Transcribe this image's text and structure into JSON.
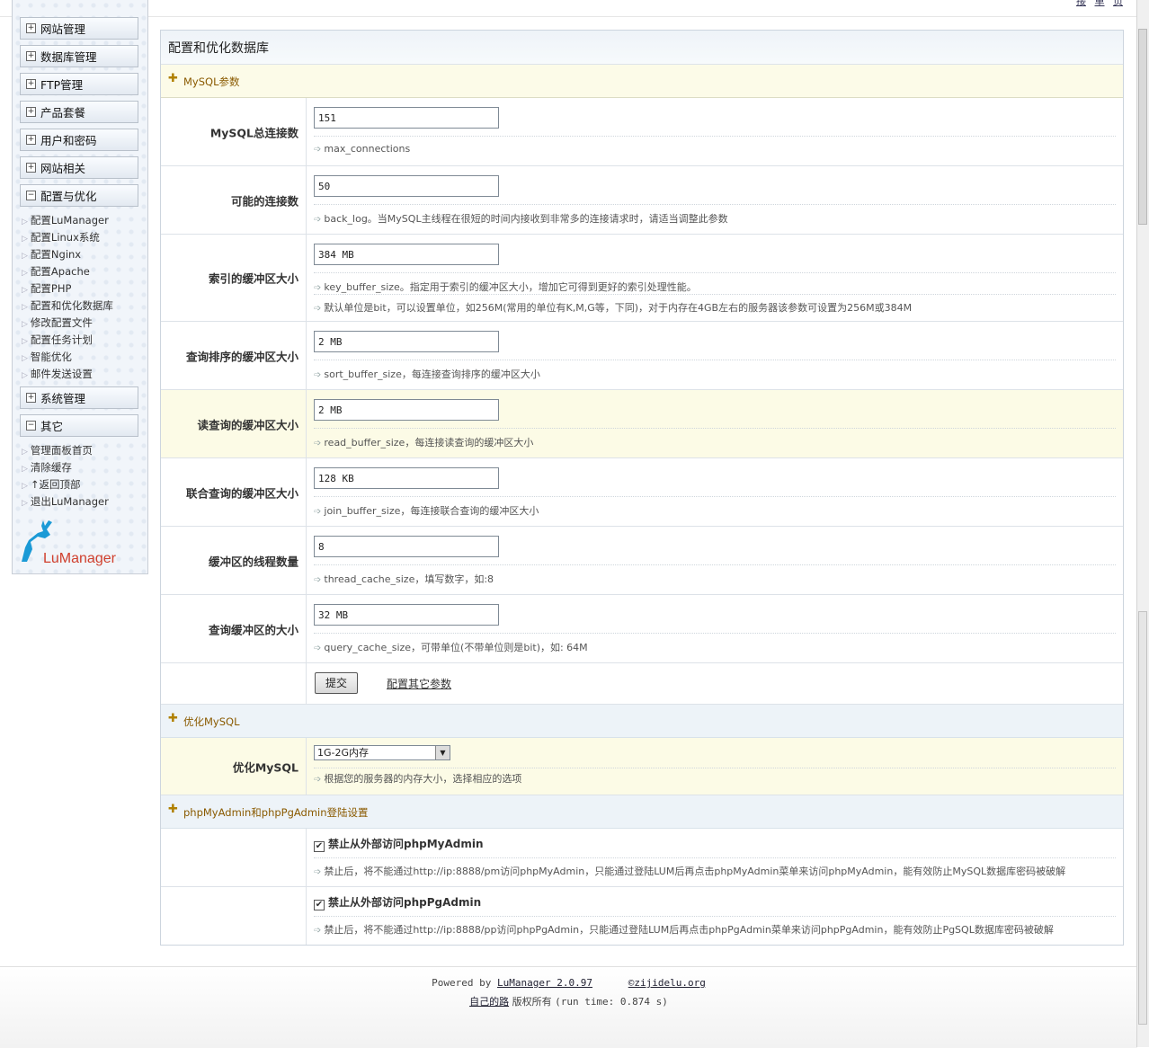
{
  "topbar": {
    "icons": "△ ⊘ ▽",
    "links": [
      "接",
      "单",
      "页"
    ]
  },
  "sidebar": {
    "menus": [
      {
        "label": "网站管理",
        "state": "+"
      },
      {
        "label": "数据库管理",
        "state": "+"
      },
      {
        "label": "FTP管理",
        "state": "+"
      },
      {
        "label": "产品套餐",
        "state": "+"
      },
      {
        "label": "用户和密码",
        "state": "+"
      },
      {
        "label": "网站相关",
        "state": "+"
      },
      {
        "label": "配置与优化",
        "state": "−"
      },
      {
        "label": "系统管理",
        "state": "+"
      },
      {
        "label": "其它",
        "state": "−"
      }
    ],
    "config_items": [
      "配置LuManager",
      "配置Linux系统",
      "配置Nginx",
      "配置Apache",
      "配置PHP",
      "配置和优化数据库",
      "修改配置文件",
      "配置任务计划",
      "智能优化",
      "邮件发送设置"
    ],
    "other_items": [
      "管理面板首页",
      "清除缓存",
      "↑返回顶部",
      "退出LuManager"
    ],
    "logo_text": "LuManager"
  },
  "main": {
    "title": "配置和优化数据库",
    "mysql_section": "MySQL参数",
    "params": [
      {
        "label": "MySQL总连接数",
        "value": "151",
        "hints": [
          "max_connections"
        ]
      },
      {
        "label": "可能的连接数",
        "value": "50",
        "hints": [
          "back_log。当MySQL主线程在很短的时间内接收到非常多的连接请求时，请适当调整此参数"
        ]
      },
      {
        "label": "索引的缓冲区大小",
        "value": "384 MB",
        "hints": [
          "key_buffer_size。指定用于索引的缓冲区大小，增加它可得到更好的索引处理性能。",
          "默认单位是bit，可以设置单位，如256M(常用的单位有K,M,G等，下同)，对于内存在4GB左右的服务器该参数可设置为256M或384M"
        ]
      },
      {
        "label": "查询排序的缓冲区大小",
        "value": "2 MB",
        "hints": [
          "sort_buffer_size，每连接查询排序的缓冲区大小"
        ]
      },
      {
        "label": "读查询的缓冲区大小",
        "value": "2 MB",
        "hints": [
          "read_buffer_size，每连接读查询的缓冲区大小"
        ]
      },
      {
        "label": "联合查询的缓冲区大小",
        "value": "128 KB",
        "hints": [
          "join_buffer_size，每连接联合查询的缓冲区大小"
        ]
      },
      {
        "label": "缓冲区的线程数量",
        "value": "8",
        "hints": [
          "thread_cache_size，填写数字，如:8"
        ]
      },
      {
        "label": "查询缓冲区的大小",
        "value": "32 MB",
        "hints": [
          "query_cache_size，可带单位(不带单位则是bit)，如: 64M"
        ]
      }
    ],
    "submit_label": "提交",
    "other_params_link": "配置其它参数",
    "optimize_section": "优化MySQL",
    "optimize_label": "优化MySQL",
    "optimize_select": "1G-2G内存",
    "optimize_hint": "根据您的服务器的内存大小，选择相应的选项",
    "php_section": "phpMyAdmin和phpPgAdmin登陆设置",
    "checks": [
      {
        "label": "禁止从外部访问phpMyAdmin",
        "hint": "禁止后，将不能通过http://ip:8888/pm访问phpMyAdmin，只能通过登陆LUM后再点击phpMyAdmin菜单来访问phpMyAdmin，能有效防止MySQL数据库密码被破解",
        "checked": "✔"
      },
      {
        "label": "禁止从外部访问phpPgAdmin",
        "hint": "禁止后，将不能通过http://ip:8888/pp访问phpPgAdmin，只能通过登陆LUM后再点击phpPgAdmin菜单来访问phpPgAdmin，能有效防止PgSQL数据库密码被破解",
        "checked": "✔"
      }
    ]
  },
  "footer": {
    "powered_prefix": "Powered by",
    "product": "LuManager 2.0.97",
    "copyright": "©zijidelu.org",
    "owner_link": "自己的路",
    "rights": "版权所有",
    "runtime": "(run time: 0.874 s)"
  }
}
